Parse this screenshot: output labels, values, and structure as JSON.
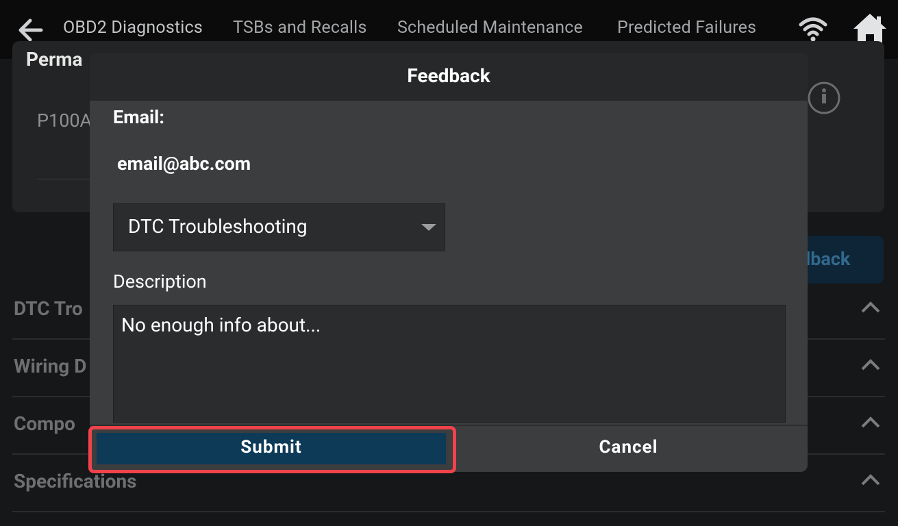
{
  "topbar": {
    "tabs": [
      {
        "label": "OBD2 Diagnostics"
      },
      {
        "label": "TSBs and Recalls"
      },
      {
        "label": "Scheduled Maintenance"
      },
      {
        "label": "Predicted Failures"
      }
    ]
  },
  "background": {
    "card_title": "Perma",
    "code": "P100A",
    "feedback_button": "dback",
    "sections": [
      {
        "label": "DTC Tro"
      },
      {
        "label": "Wiring D"
      },
      {
        "label": "Compo"
      },
      {
        "label": "Specifications"
      }
    ]
  },
  "modal": {
    "title": "Feedback",
    "email_label": "Email:",
    "email_value": "email@abc.com",
    "category_selected": "DTC Troubleshooting",
    "description_label": "Description",
    "description_value": "No enough info about...",
    "submit_label": "Submit",
    "cancel_label": "Cancel"
  },
  "colors": {
    "accent": "#0d3a57",
    "highlight": "#f0434b",
    "modal_bg": "#3b3d3f"
  },
  "icons": [
    "back-arrow-icon",
    "wifi-icon",
    "home-icon",
    "info-icon",
    "chevron-up-icon",
    "dropdown-caret-icon"
  ]
}
